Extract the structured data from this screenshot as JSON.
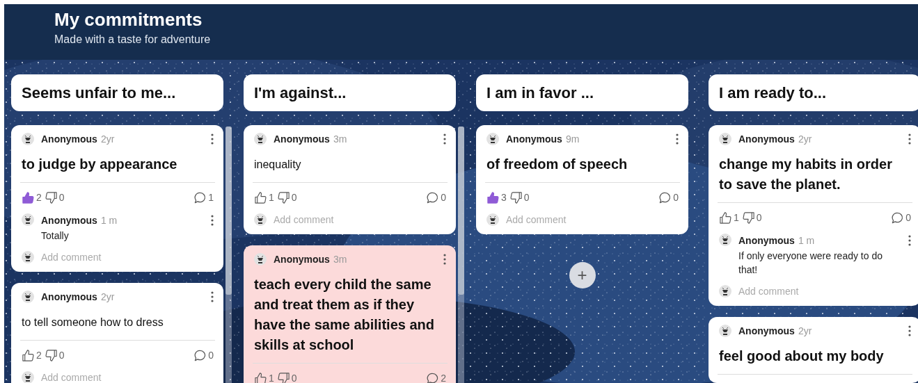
{
  "header": {
    "title": "My commitments",
    "subtitle": "Made with a taste for adventure"
  },
  "columns": [
    {
      "title": "Seems unfair to me...",
      "scrollable": true,
      "cards": [
        {
          "author": "Anonymous",
          "time": "2yr",
          "text": "to judge by appearance",
          "bold": true,
          "color": "#ffffff",
          "reactions": {
            "likes": "2",
            "liked": true,
            "dislikes": "0",
            "comment_count": "1"
          },
          "comments": [
            {
              "author": "Anonymous",
              "time": "1 m",
              "text": "Totally"
            }
          ],
          "add_comment": {
            "placeholder": "Add comment"
          }
        },
        {
          "author": "Anonymous",
          "time": "2yr",
          "text": "to tell someone how to dress",
          "bold": false,
          "color": "#ffffff",
          "reactions": {
            "likes": "2",
            "liked": false,
            "dislikes": "0",
            "comment_count": "0"
          },
          "add_comment": {
            "placeholder": "Add comment"
          }
        }
      ]
    },
    {
      "title": "I'm against...",
      "scrollable": true,
      "cards": [
        {
          "author": "Anonymous",
          "time": "3m",
          "text": "inequality",
          "bold": false,
          "color": "#ffffff",
          "reactions": {
            "likes": "1",
            "liked": false,
            "dislikes": "0",
            "comment_count": "0"
          },
          "add_comment": {
            "placeholder": "Add comment"
          }
        },
        {
          "author": "Anonymous",
          "time": "3m",
          "text": "teach every child the same and treat them as if they have the same abilities and skills at school",
          "bold": true,
          "color": "#fcdada",
          "reactions": {
            "likes": "1",
            "liked": false,
            "dislikes": "0",
            "comment_count": "2"
          }
        }
      ]
    },
    {
      "title": "I am in favor ...",
      "scrollable": false,
      "cards": [
        {
          "author": "Anonymous",
          "time": "9m",
          "text": "of freedom of speech",
          "bold": true,
          "color": "#ffffff",
          "reactions": {
            "likes": "3",
            "liked": true,
            "dislikes": "0",
            "comment_count": "0"
          },
          "add_comment": {
            "placeholder": "Add comment"
          }
        }
      ],
      "add_button": "+"
    },
    {
      "title": "I am ready to...",
      "scrollable": false,
      "cards": [
        {
          "author": "Anonymous",
          "time": "2yr",
          "text": "change my habits in order to save the planet.",
          "bold": true,
          "color": "#ffffff",
          "reactions": {
            "likes": "1",
            "liked": false,
            "dislikes": "0",
            "comment_count": "0"
          },
          "comments": [
            {
              "author": "Anonymous",
              "time": "1 m",
              "text": "If only everyone were ready to do that!"
            }
          ],
          "add_comment": {
            "placeholder": "Add comment"
          }
        },
        {
          "author": "Anonymous",
          "time": "2yr",
          "text": "feel good about my body",
          "bold": true,
          "color": "#ffffff"
        }
      ]
    }
  ]
}
